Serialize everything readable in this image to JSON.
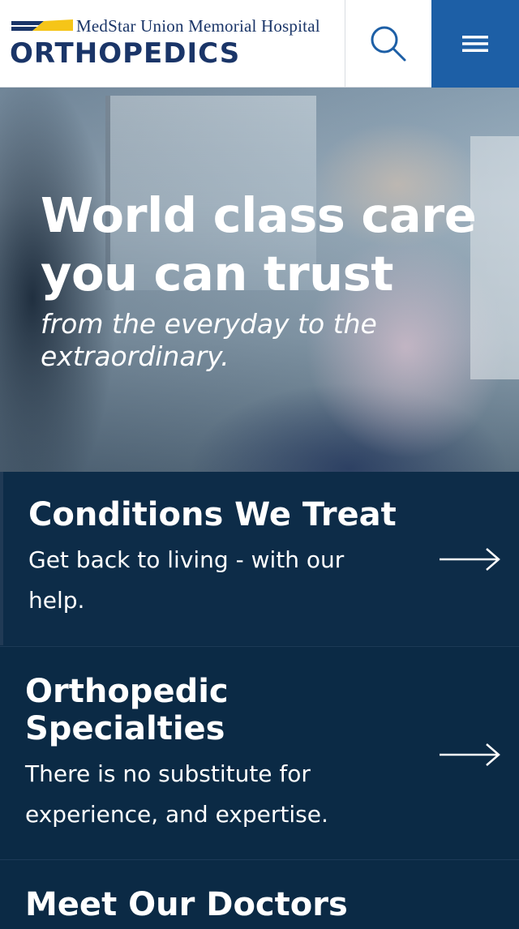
{
  "header": {
    "hospital_name": "MedStar Union Memorial Hospital",
    "department": "ORTHOPEDICS",
    "search_icon": "search-icon",
    "menu_icon": "hamburger-menu-icon",
    "brand_color": "#1a3568",
    "menu_bg_color": "#1d5fa6"
  },
  "hero": {
    "title": "World class care you can trust",
    "subtitle": "from the everyday to the extraordinary."
  },
  "cards": [
    {
      "title": "Conditions We Treat",
      "description": "Get back to living - with our help.",
      "icon": "arrow-right-icon"
    },
    {
      "title": "Orthopedic Specialties",
      "description": "There is no substitute for experience, and expertise.",
      "icon": "arrow-right-icon"
    },
    {
      "title": "Meet Our Doctors"
    }
  ],
  "colors": {
    "card_bg": "#0b2a45",
    "accent_yellow": "#f5c518"
  }
}
